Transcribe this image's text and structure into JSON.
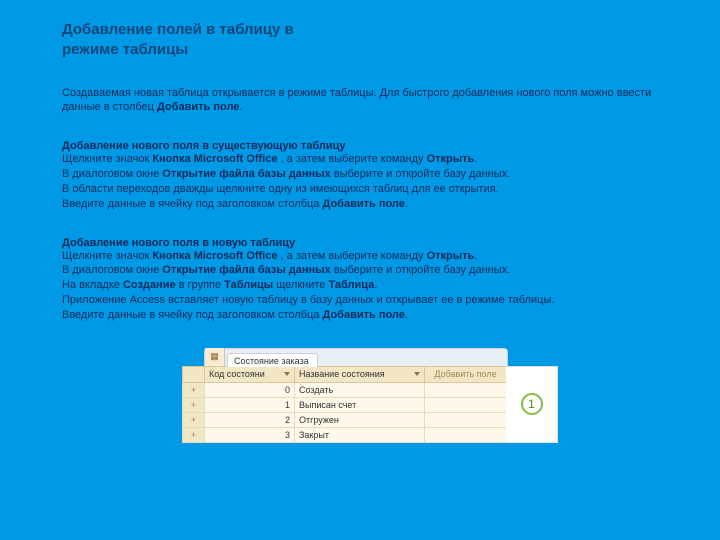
{
  "title": {
    "line1": "Добавление полей в таблицу в",
    "line2": "режиме таблицы"
  },
  "intro": {
    "text1": "Создаваемая новая таблица открывается в режиме таблицы. Для быстрого добавления нового поля можно ввести данные в столбец",
    "bold1": "Добавить поле",
    "end1": "."
  },
  "sec2": {
    "heading": "Добавление нового поля в существующую таблицу",
    "l1a": "Щелкните значок",
    "l1b": "Кнопка Microsoft Office",
    "l1c": ", а затем выберите команду",
    "l1d": "Открыть",
    "l1e": ".",
    "l2a": "В диалоговом окне",
    "l2b": "Открытие файла базы данных",
    "l2c": "выберите и откройте базу данных.",
    "l3": "В области переходов дважды щелкните одну из имеющихся таблиц для ее открытия.",
    "l4a": "Введите данные в ячейку под заголовком столбца",
    "l4b": "Добавить поле",
    "l4c": "."
  },
  "sec3": {
    "heading": "Добавление нового поля в новую таблицу",
    "l1a": "Щелкните значок",
    "l1b": "Кнопка Microsoft Office",
    "l1c": ", а затем выберите команду",
    "l1d": "Открыть",
    "l1e": ".",
    "l2a": "В диалоговом окне",
    "l2b": "Открытие файла базы данных",
    "l2c": "выберите и откройте базу данных.",
    "l3a": "На вкладке",
    "l3b": "Создание",
    "l3c": "в группе",
    "l3d": "Таблицы",
    "l3e": "щелкните",
    "l3f": "Таблица",
    "l3g": ".",
    "l4": "Приложение Access вставляет новую таблицу в базу данных и открывает ее в режиме таблицы.",
    "l5a": "Введите данные в ячейку под заголовком столбца",
    "l5b": "Добавить поле",
    "l5c": "."
  },
  "screenshot": {
    "tab": "Состояние заказа",
    "col1": "Код состояни",
    "col2": "Название состояния",
    "col3": "Добавить поле",
    "callout": "1",
    "rows": [
      {
        "id": "0",
        "name": "Создать"
      },
      {
        "id": "1",
        "name": "Выписан счет"
      },
      {
        "id": "2",
        "name": "Отгружен"
      },
      {
        "id": "3",
        "name": "Закрыт"
      }
    ]
  }
}
